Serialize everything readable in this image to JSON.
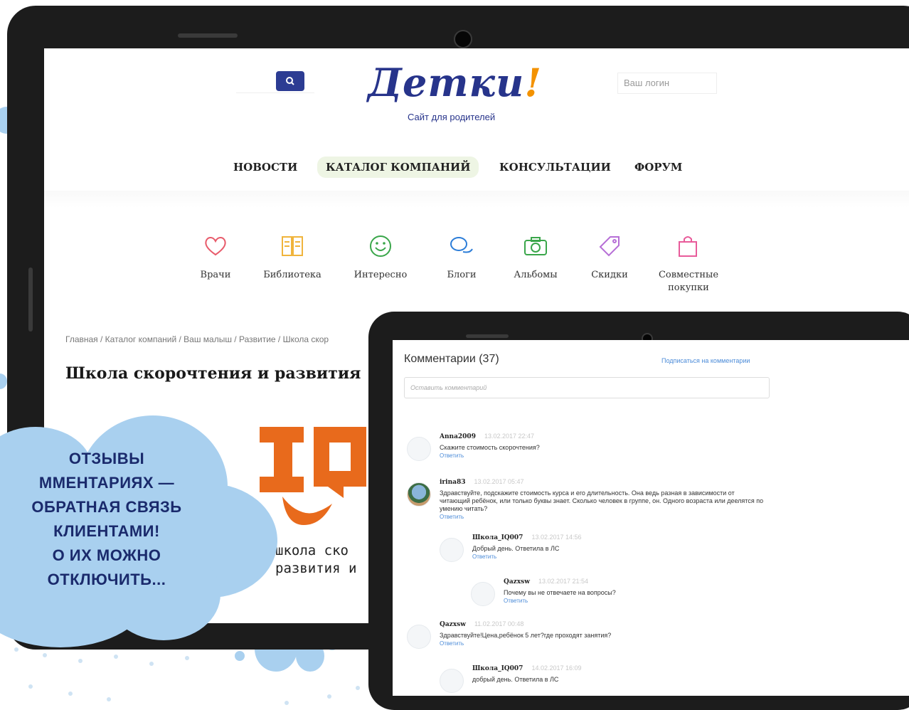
{
  "colors": {
    "accent": "#27348b",
    "logo_mark": "#f39200",
    "cloud": "#a9d0ef",
    "link": "#4b8bd8"
  },
  "header": {
    "logo": "Детки",
    "logo_mark": "!",
    "tagline": "Сайт для родителей",
    "search_icon": "search-icon",
    "login_placeholder": "Ваш логин"
  },
  "nav": {
    "items": [
      {
        "label": "НОВОСТИ"
      },
      {
        "label": "КАТАЛОГ КОМПАНИЙ",
        "active": true
      },
      {
        "label": "КОНСУЛЬТАЦИИ"
      },
      {
        "label": "ФОРУМ"
      }
    ]
  },
  "categories": [
    {
      "label": "Врачи",
      "icon": "heart-icon",
      "color": "#e85b6b"
    },
    {
      "label": "Библиотека",
      "icon": "book-icon",
      "color": "#f0b43c"
    },
    {
      "label": "Интересно",
      "icon": "smile-icon",
      "color": "#3aa64a"
    },
    {
      "label": "Блоги",
      "icon": "chat-icon",
      "color": "#2c7dd8"
    },
    {
      "label": "Альбомы",
      "icon": "camera-icon",
      "color": "#3aa64a"
    },
    {
      "label": "Скидки",
      "icon": "tag-icon",
      "color": "#b66fd6"
    },
    {
      "label": "Совместные покупки",
      "icon": "bag-icon",
      "color": "#e85b9a"
    }
  ],
  "breadcrumb": "Главная / Каталог компаний / Ваш малыш / Развитие / Школа скор",
  "page_title": "Школа скорочтения и развития",
  "company": {
    "logo_text": "IQ",
    "name_line1": "школа ско",
    "name_line2": "развития и"
  },
  "callout": {
    "line1": "ОТЗЫВЫ",
    "line2": "ММЕНТАРИЯХ —",
    "line3": "ОБРАТНАЯ СВЯЗЬ",
    "line4": "КЛИЕНТАМИ!",
    "line5": "О ИХ МОЖНО",
    "line6": "ОТКЛЮЧИТЬ..."
  },
  "tablet": {
    "title": "Комментарии (37)",
    "subscribe": "Подписаться на комментарии",
    "input_placeholder": "Оставить комментарий",
    "comments": [
      {
        "author": "Anna2009",
        "date": "13.02.2017 22:47",
        "text": "Скажите стоимость скорочтения?",
        "reply": "Ответить"
      },
      {
        "author": "irina83",
        "date": "13.02.2017 05:47",
        "text": "Здравствуйте, подскажите стоимость курса и его длительность. Она ведь разная в зависимости от читающий ребёнок, или только буквы знает. Сколько человек в группе, он. Одного возраста или деелятся по умению читать?",
        "reply": "Ответить"
      },
      {
        "author": "Школа_IQ007",
        "date": "13.02.2017 14:56",
        "text": "Добрый день. Ответила в ЛС",
        "reply": "Ответить"
      },
      {
        "author": "Qazxsw",
        "date": "13.02.2017 21:54",
        "text": "Почему вы не отвечаете на вопросы?",
        "reply": "Ответить"
      },
      {
        "author": "Qazxsw",
        "date": "11.02.2017 00:48",
        "text": "Здравствуйте!Цена,ребёнок 5 лет?где проходят занятия?",
        "reply": "Ответить"
      },
      {
        "author": "Школа_IQ007",
        "date": "14.02.2017 16:09",
        "text": "добрый день. Ответила в ЛС",
        "reply": ""
      }
    ]
  }
}
